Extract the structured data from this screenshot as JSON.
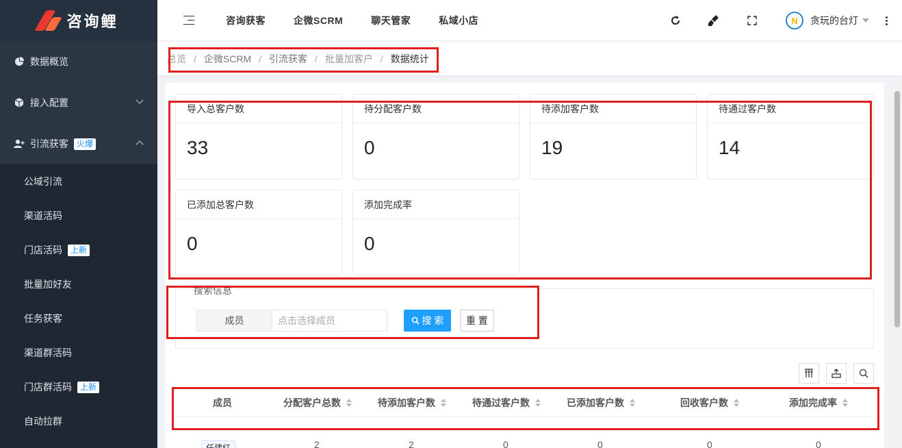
{
  "brand": {
    "name": "咨询鲤"
  },
  "sidebar": {
    "groups": [
      {
        "label": "数据概览"
      },
      {
        "label": "接入配置"
      },
      {
        "label": "引流获客",
        "badge": "火爆"
      }
    ],
    "sub_items": [
      {
        "label": "公域引流"
      },
      {
        "label": "渠道活码"
      },
      {
        "label": "门店活码",
        "badge": "上新"
      },
      {
        "label": "批量加好友"
      },
      {
        "label": "任务获客"
      },
      {
        "label": "渠道群活码"
      },
      {
        "label": "门店群活码",
        "badge": "上新"
      },
      {
        "label": "自动拉群"
      }
    ]
  },
  "header": {
    "nav": [
      "咨询获客",
      "企微SCRM",
      "聊天管家",
      "私域小店"
    ],
    "avatar_letter": "N",
    "username": "贪玩的台灯"
  },
  "breadcrumb": [
    "总览",
    "企微SCRM",
    "引流获客",
    "批量加客户",
    "数据统计"
  ],
  "stats": [
    {
      "title": "导入总客户数",
      "value": "33"
    },
    {
      "title": "待分配客户数",
      "value": "0"
    },
    {
      "title": "待添加客户数",
      "value": "19"
    },
    {
      "title": "待通过客户数",
      "value": "14"
    },
    {
      "title": "已添加总客户数",
      "value": "0"
    },
    {
      "title": "添加完成率",
      "value": "0"
    }
  ],
  "search": {
    "legend": "搜索信息",
    "member_label": "成员",
    "member_placeholder": "点击选择成员",
    "search_btn": "搜 索",
    "reset_btn": "重 置"
  },
  "table": {
    "columns": [
      "成员",
      "分配客户总数",
      "待添加客户数",
      "待通过客户数",
      "已添加客户数",
      "回收客户数",
      "添加完成率"
    ],
    "rows": [
      {
        "member": "任建红",
        "assigned": "2",
        "pending_add": "2",
        "pending_pass": "0",
        "added": "0",
        "recycled": "0",
        "rate": "0"
      }
    ]
  },
  "colors": {
    "sidebar_bg": "#2b3643",
    "accent": "#1e9fff",
    "highlight": "#e02020"
  }
}
